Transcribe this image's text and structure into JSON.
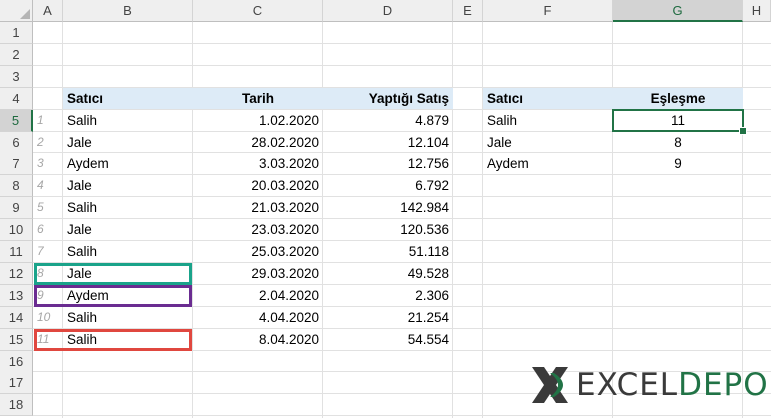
{
  "columns": [
    "A",
    "B",
    "C",
    "D",
    "E",
    "F",
    "G",
    "H"
  ],
  "rows": [
    "1",
    "2",
    "3",
    "4",
    "5",
    "6",
    "7",
    "8",
    "9",
    "10",
    "11",
    "12",
    "13",
    "14",
    "15",
    "16",
    "17",
    "18"
  ],
  "active_column": "G",
  "active_row": "5",
  "left_table": {
    "headers": {
      "seller": "Satıcı",
      "date": "Tarih",
      "sales": "Yaptığı Satış"
    },
    "records": [
      {
        "n": "1",
        "seller": "Salih",
        "date": "1.02.2020",
        "sales": "4.879"
      },
      {
        "n": "2",
        "seller": "Jale",
        "date": "28.02.2020",
        "sales": "12.104"
      },
      {
        "n": "3",
        "seller": "Aydem",
        "date": "3.03.2020",
        "sales": "12.756"
      },
      {
        "n": "4",
        "seller": "Jale",
        "date": "20.03.2020",
        "sales": "6.792"
      },
      {
        "n": "5",
        "seller": "Salih",
        "date": "21.03.2020",
        "sales": "142.984"
      },
      {
        "n": "6",
        "seller": "Jale",
        "date": "23.03.2020",
        "sales": "120.536"
      },
      {
        "n": "7",
        "seller": "Salih",
        "date": "25.03.2020",
        "sales": "51.118"
      },
      {
        "n": "8",
        "seller": "Jale",
        "date": "29.03.2020",
        "sales": "49.528"
      },
      {
        "n": "9",
        "seller": "Aydem",
        "date": "2.04.2020",
        "sales": "2.306"
      },
      {
        "n": "10",
        "seller": "Salih",
        "date": "4.04.2020",
        "sales": "21.254"
      },
      {
        "n": "11",
        "seller": "Salih",
        "date": "8.04.2020",
        "sales": "54.554"
      }
    ]
  },
  "right_table": {
    "headers": {
      "seller": "Satıcı",
      "match": "Eşleşme"
    },
    "records": [
      {
        "seller": "Salih",
        "match": "11"
      },
      {
        "seller": "Jale",
        "match": "8"
      },
      {
        "seller": "Aydem",
        "match": "9"
      }
    ]
  },
  "highlight_colors": {
    "jale": "#1aa38a",
    "aydem": "#6a2c91",
    "salih": "#e0473f"
  },
  "logo": {
    "part1": "EXCEL",
    "part2": "DEPO"
  }
}
